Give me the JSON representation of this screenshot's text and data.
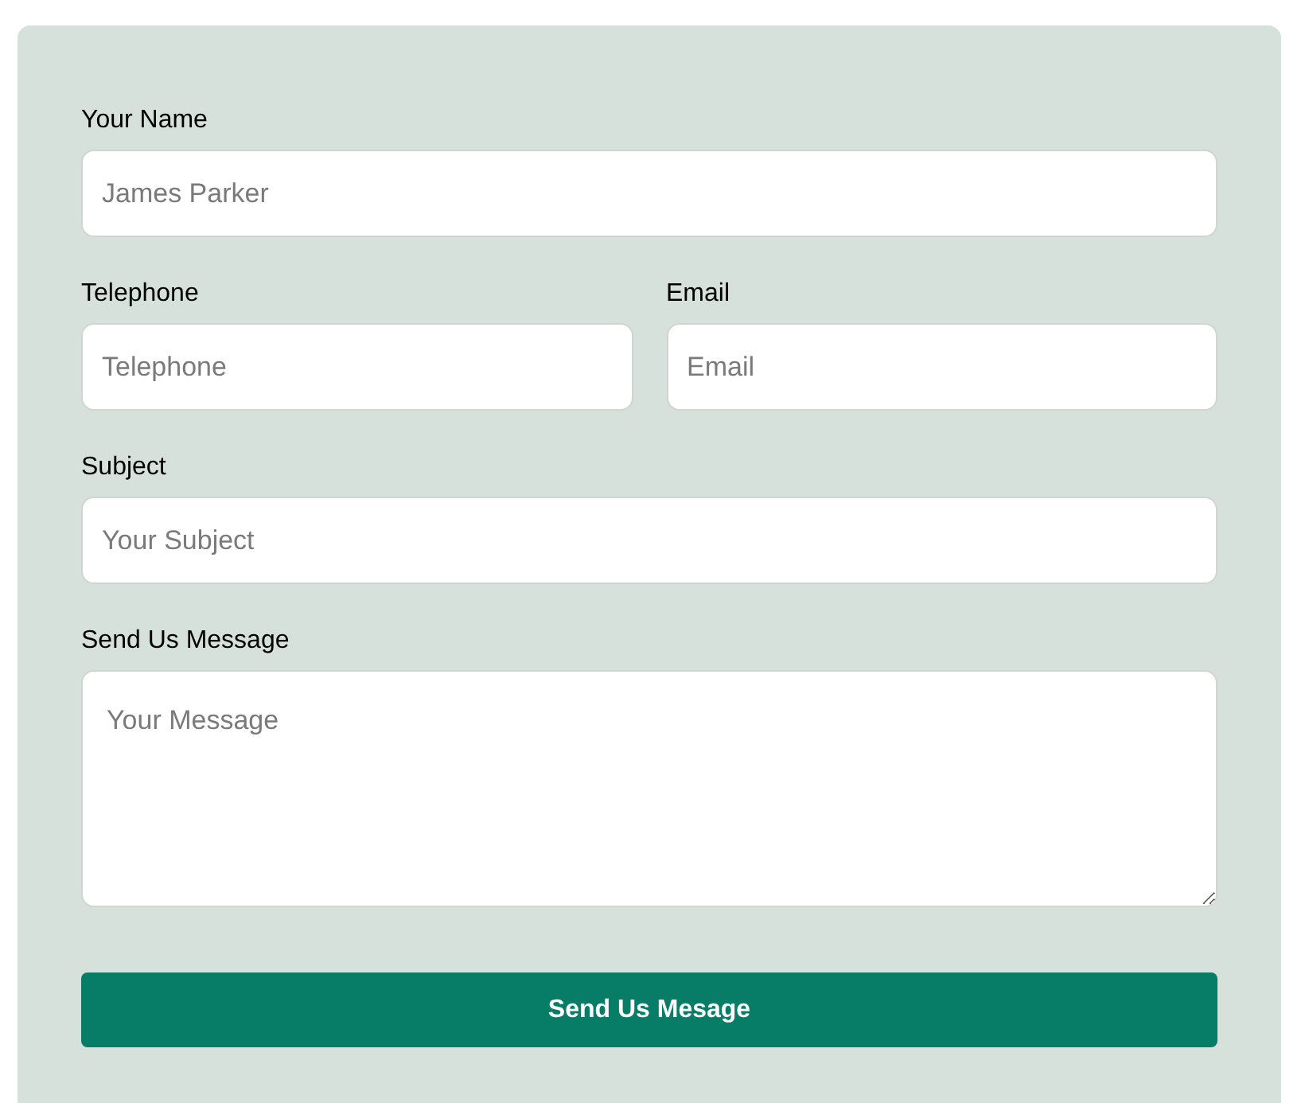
{
  "form": {
    "rows": [
      {
        "fields": [
          {
            "kind": "input",
            "label": "Your Name",
            "placeholder": "James Parker"
          }
        ]
      },
      {
        "fields": [
          {
            "kind": "input",
            "label": "Telephone",
            "placeholder": "Telephone"
          },
          {
            "kind": "input",
            "label": "Email",
            "placeholder": "Email"
          }
        ]
      },
      {
        "fields": [
          {
            "kind": "input",
            "label": "Subject",
            "placeholder": "Your Subject"
          }
        ]
      },
      {
        "fields": [
          {
            "kind": "textarea",
            "label": "Send Us Message",
            "placeholder": "Your Message"
          }
        ]
      }
    ],
    "submit_button": "Send Us Mesage"
  }
}
